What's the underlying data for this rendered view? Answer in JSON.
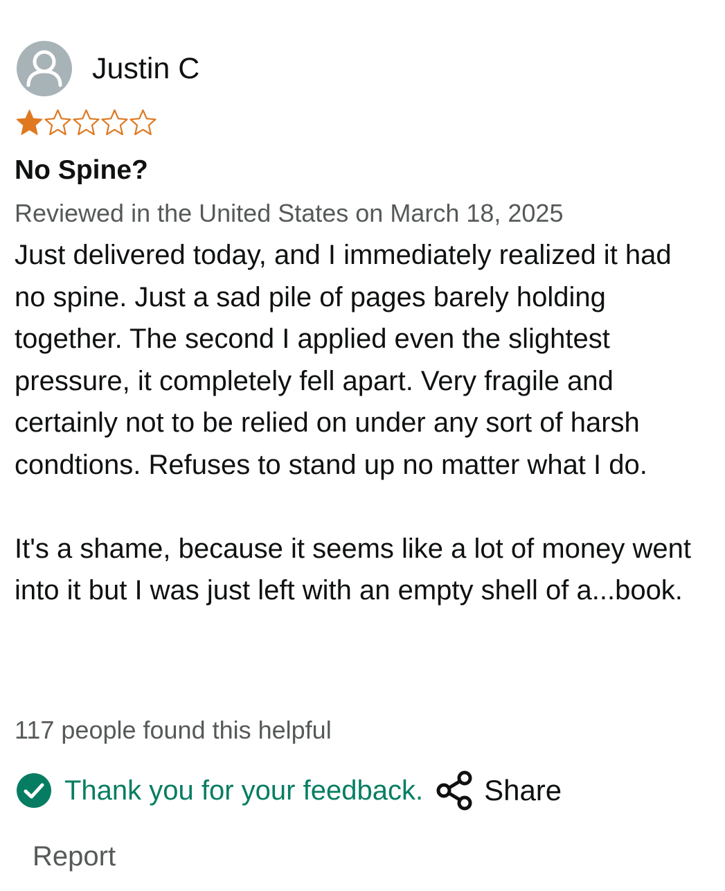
{
  "reviewer": {
    "name": "Justin C",
    "avatar_icon": "user-silhouette-icon"
  },
  "rating": {
    "value": 1,
    "max": 5,
    "filled_color": "#de7921",
    "empty_color": "#de7921"
  },
  "review": {
    "title": "No Spine?",
    "meta": "Reviewed in the United States on March 18, 2025",
    "paragraphs": [
      "Just delivered today, and I immediately realized it had no spine. Just a sad pile of pages barely holding together. The second I applied even the slightest pressure, it completely fell apart. Very fragile and certainly not to be relied on under any sort of harsh condtions. Refuses to stand up no matter what I do.",
      "It's a shame, because it seems like a lot of money went into it but I was just left with an empty shell of a...book."
    ],
    "helpful_count": "117 people found this helpful"
  },
  "actions": {
    "feedback_text": "Thank you for your feedback.",
    "feedback_icon": "check-circle-icon",
    "feedback_color": "#067d62",
    "share_label": "Share",
    "share_icon": "share-icon",
    "report_label": "Report"
  }
}
